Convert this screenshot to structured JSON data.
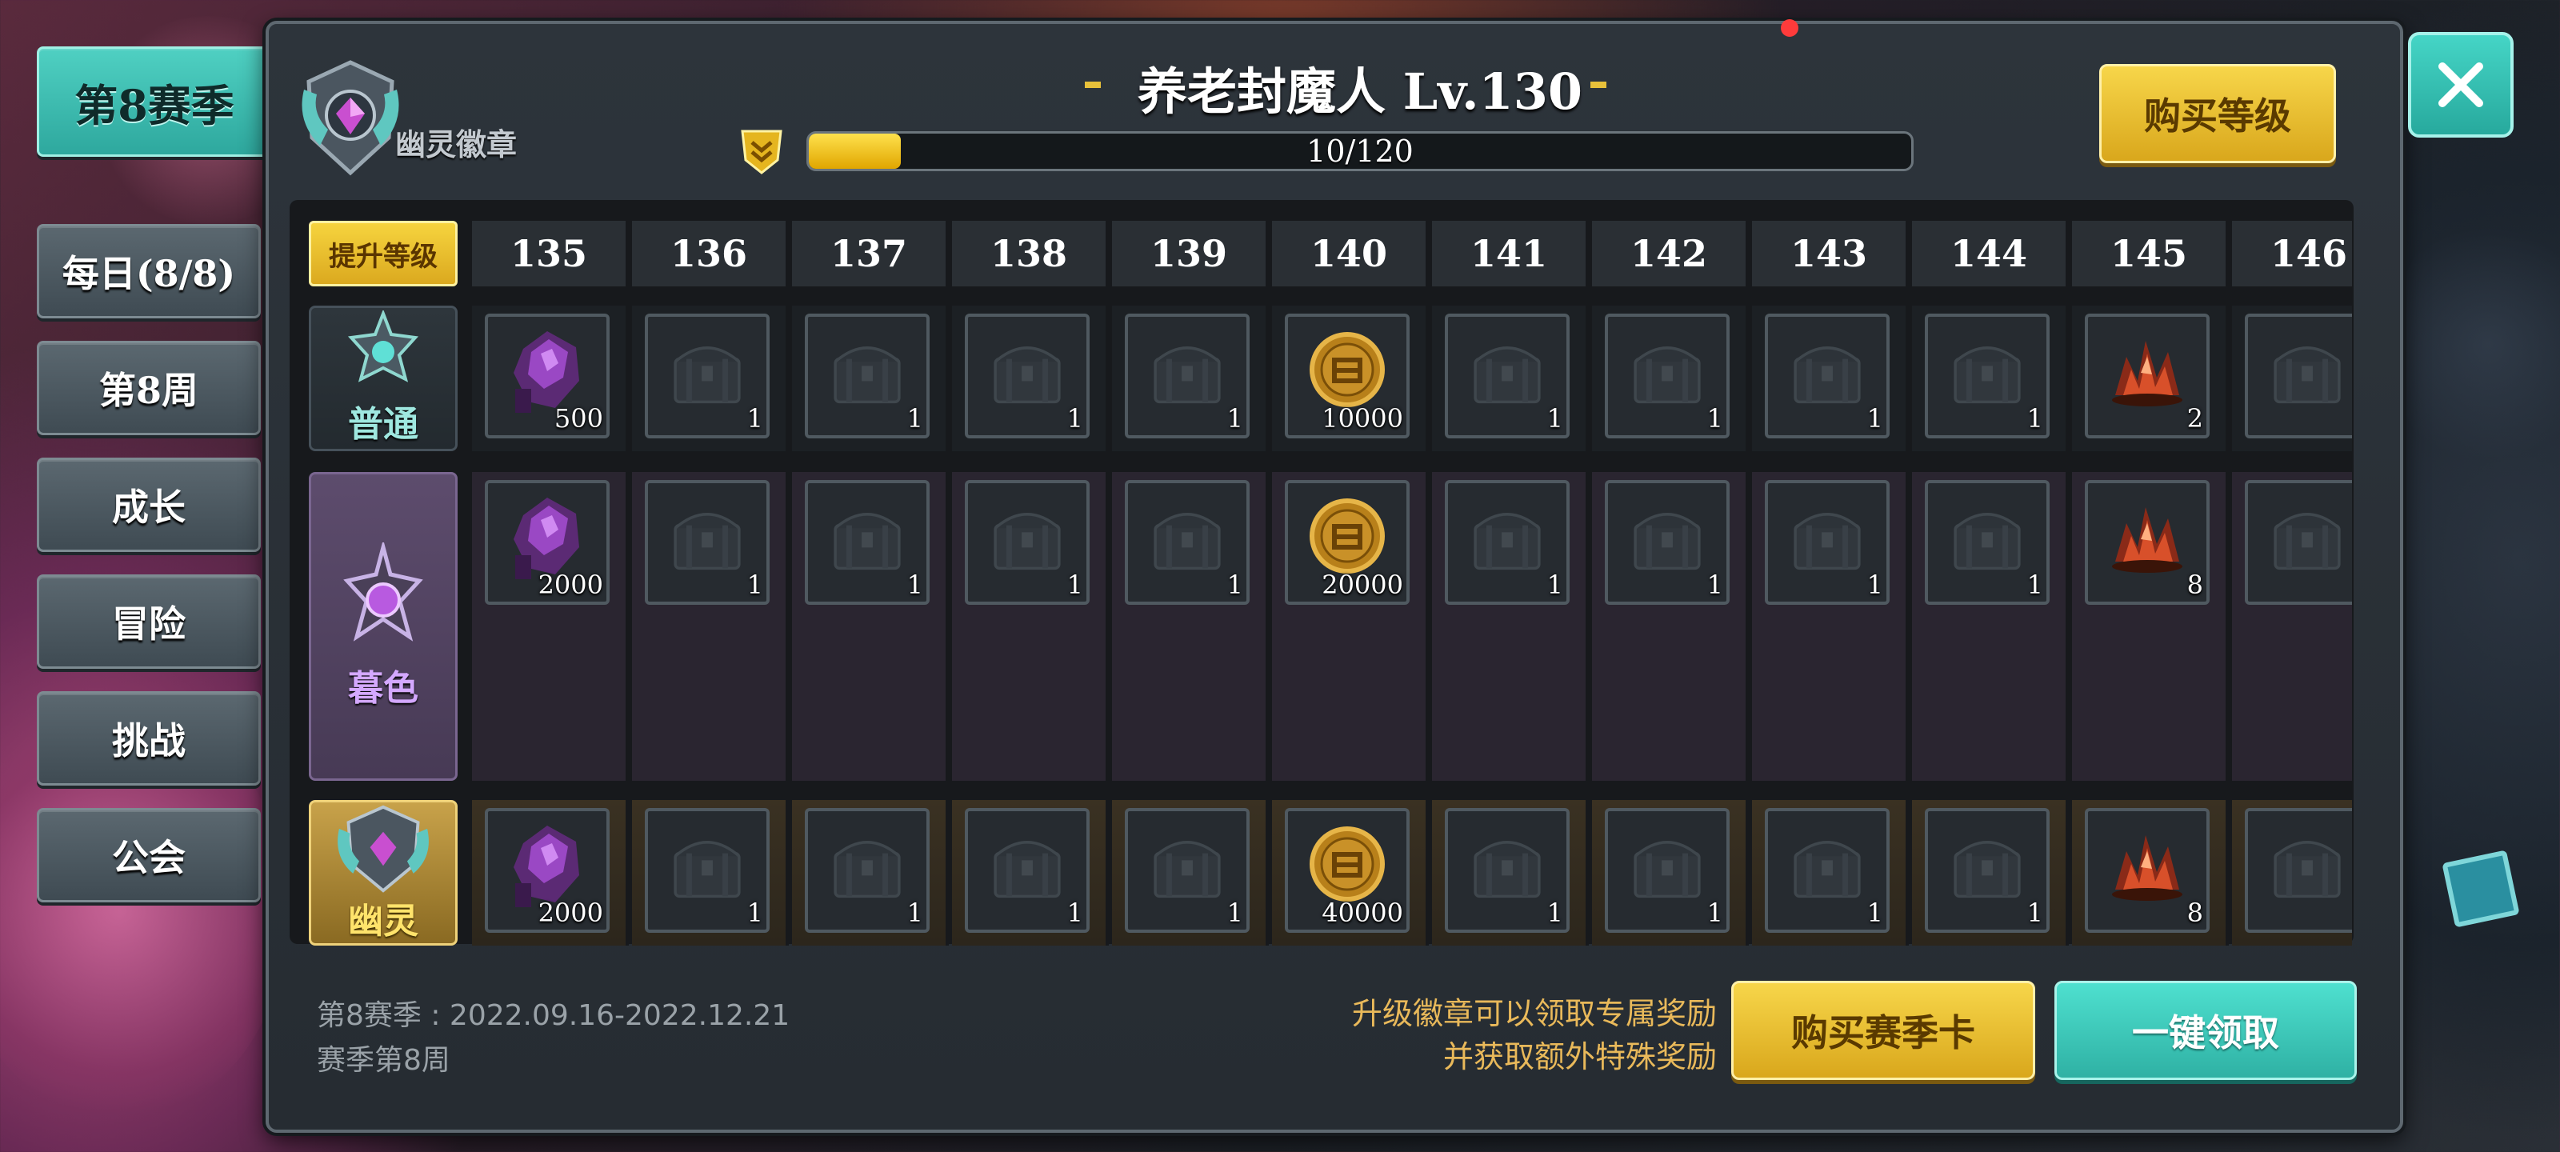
{
  "nav": {
    "items": [
      {
        "label": "第8赛季",
        "active": true
      },
      {
        "label": "每日(8/8)",
        "active": false
      },
      {
        "label": "第8周",
        "active": false
      },
      {
        "label": "成长",
        "active": false
      },
      {
        "label": "冒险",
        "active": false
      },
      {
        "label": "挑战",
        "active": false
      },
      {
        "label": "公会",
        "active": false
      }
    ]
  },
  "header": {
    "badge_name": "幽灵徽章",
    "player_title": "养老封魔人 Lv.130",
    "progress": {
      "text": "10/120",
      "current": 10,
      "max": 120,
      "fill_fraction": 0.083
    },
    "buy_level_label": "购买等级",
    "close_icon": "close-icon"
  },
  "grid": {
    "upgrade_label": "提升等级",
    "levels": [
      "135",
      "136",
      "137",
      "138",
      "139",
      "140",
      "141",
      "142",
      "143",
      "144",
      "145",
      "146"
    ],
    "tracks": [
      {
        "key": "normal",
        "label": "普通",
        "color": "#9fe8e0",
        "rewards": [
          {
            "item": "purple-crystal",
            "qty": "500"
          },
          {
            "item": "chest",
            "qty": "1"
          },
          {
            "item": "chest",
            "qty": "1"
          },
          {
            "item": "chest",
            "qty": "1"
          },
          {
            "item": "chest",
            "qty": "1"
          },
          {
            "item": "gold-coin",
            "qty": "10000"
          },
          {
            "item": "chest",
            "qty": "1"
          },
          {
            "item": "chest",
            "qty": "1"
          },
          {
            "item": "chest",
            "qty": "1"
          },
          {
            "item": "chest",
            "qty": "1"
          },
          {
            "item": "red-crystal",
            "qty": "2"
          },
          {
            "item": "chest",
            "qty": ""
          }
        ]
      },
      {
        "key": "dusk",
        "label": "暮色",
        "color": "#d4a8ff",
        "rewards": [
          {
            "item": "purple-crystal",
            "qty": "2000"
          },
          {
            "item": "chest",
            "qty": "1"
          },
          {
            "item": "chest",
            "qty": "1"
          },
          {
            "item": "chest",
            "qty": "1"
          },
          {
            "item": "chest",
            "qty": "1"
          },
          {
            "item": "gold-coin",
            "qty": "20000"
          },
          {
            "item": "chest",
            "qty": "1"
          },
          {
            "item": "chest",
            "qty": "1"
          },
          {
            "item": "chest",
            "qty": "1"
          },
          {
            "item": "chest",
            "qty": "1"
          },
          {
            "item": "red-crystal",
            "qty": "8"
          },
          {
            "item": "chest",
            "qty": ""
          }
        ]
      },
      {
        "key": "ghost",
        "label": "幽灵",
        "color": "#ffe36b",
        "rewards": [
          {
            "item": "purple-crystal",
            "qty": "2000"
          },
          {
            "item": "chest",
            "qty": "1"
          },
          {
            "item": "chest",
            "qty": "1"
          },
          {
            "item": "chest",
            "qty": "1"
          },
          {
            "item": "chest",
            "qty": "1"
          },
          {
            "item": "gold-coin",
            "qty": "40000"
          },
          {
            "item": "chest",
            "qty": "1"
          },
          {
            "item": "chest",
            "qty": "1"
          },
          {
            "item": "chest",
            "qty": "1"
          },
          {
            "item": "chest",
            "qty": "1"
          },
          {
            "item": "red-crystal",
            "qty": "8"
          },
          {
            "item": "chest",
            "qty": ""
          }
        ]
      }
    ]
  },
  "footer": {
    "season_dates": "第8赛季 : 2022.09.16-2022.12.21",
    "season_week": "赛季第8周",
    "hint_line1": "升级徽章可以领取专属奖励",
    "hint_line2": "并获取额外特殊奖励",
    "buy_season_card_label": "购买赛季卡",
    "claim_all_label": "一键领取"
  },
  "colors": {
    "accent_teal": "#2ea89e",
    "accent_gold": "#f7d64a",
    "hint_text": "#e9b95a"
  }
}
